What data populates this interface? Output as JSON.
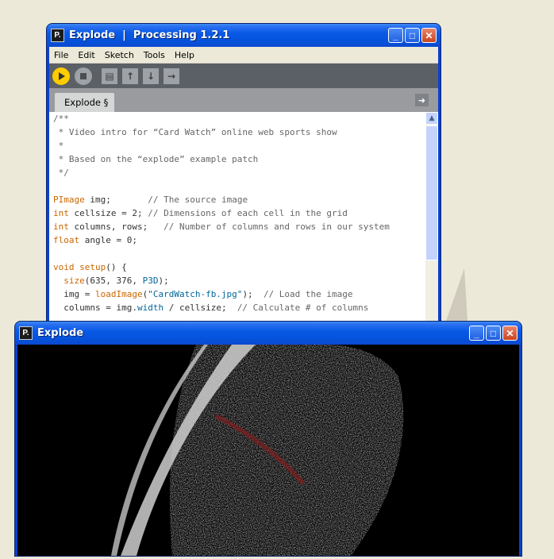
{
  "editor_window": {
    "title": "Explode  |  Processing 1.2.1",
    "icon": "P.",
    "menu": [
      "File",
      "Edit",
      "Sketch",
      "Tools",
      "Help"
    ],
    "toolbar": {
      "run_icon": "play-icon",
      "stop_icon": "stop-icon",
      "buttons": [
        "new-icon",
        "open-icon",
        "save-icon",
        "export-icon"
      ]
    },
    "tab_label": "Explode §",
    "code": [
      [
        {
          "c": "cm",
          "t": "/**"
        }
      ],
      [
        {
          "c": "cm",
          "t": " * Video intro for “Card Watch” online web sports show"
        }
      ],
      [
        {
          "c": "cm",
          "t": " *"
        }
      ],
      [
        {
          "c": "cm",
          "t": " * Based on the “explode” example patch"
        }
      ],
      [
        {
          "c": "cm",
          "t": " */"
        }
      ],
      [
        {
          "c": "",
          "t": ""
        }
      ],
      [
        {
          "c": "kw",
          "t": "PImage"
        },
        {
          "c": "",
          "t": " img;       "
        },
        {
          "c": "cm",
          "t": "// The source image"
        }
      ],
      [
        {
          "c": "kw",
          "t": "int"
        },
        {
          "c": "",
          "t": " cellsize = 2; "
        },
        {
          "c": "cm",
          "t": "// Dimensions of each cell in the grid"
        }
      ],
      [
        {
          "c": "kw",
          "t": "int"
        },
        {
          "c": "",
          "t": " columns, rows;   "
        },
        {
          "c": "cm",
          "t": "// Number of columns and rows in our system"
        }
      ],
      [
        {
          "c": "kw",
          "t": "float"
        },
        {
          "c": "",
          "t": " angle = 0;"
        }
      ],
      [
        {
          "c": "",
          "t": ""
        }
      ],
      [
        {
          "c": "kw",
          "t": "void"
        },
        {
          "c": "",
          "t": " "
        },
        {
          "c": "kw",
          "t": "setup"
        },
        {
          "c": "",
          "t": "() {"
        }
      ],
      [
        {
          "c": "",
          "t": "  "
        },
        {
          "c": "kw",
          "t": "size"
        },
        {
          "c": "",
          "t": "(635, 376, "
        },
        {
          "c": "fn",
          "t": "P3D"
        },
        {
          "c": "",
          "t": ");"
        }
      ],
      [
        {
          "c": "",
          "t": "  img = "
        },
        {
          "c": "kw",
          "t": "loadImage"
        },
        {
          "c": "",
          "t": "("
        },
        {
          "c": "str",
          "t": "\"CardWatch-fb.jpg\""
        },
        {
          "c": "",
          "t": ");  "
        },
        {
          "c": "cm",
          "t": "// Load the image"
        }
      ],
      [
        {
          "c": "",
          "t": "  columns = img."
        },
        {
          "c": "fn",
          "t": "width"
        },
        {
          "c": "",
          "t": " / cellsize;  "
        },
        {
          "c": "cm",
          "t": "// Calculate # of columns"
        }
      ]
    ]
  },
  "sketch_window": {
    "title": "Explode",
    "icon": "P."
  },
  "colors": {
    "xp_title_blue": "#0553dd",
    "desktop_bg": "#ece9d8",
    "processing_toolbar": "#5b6066",
    "run_button": "#ffcc00",
    "keyword": "#cc6600",
    "comment": "#666666"
  }
}
